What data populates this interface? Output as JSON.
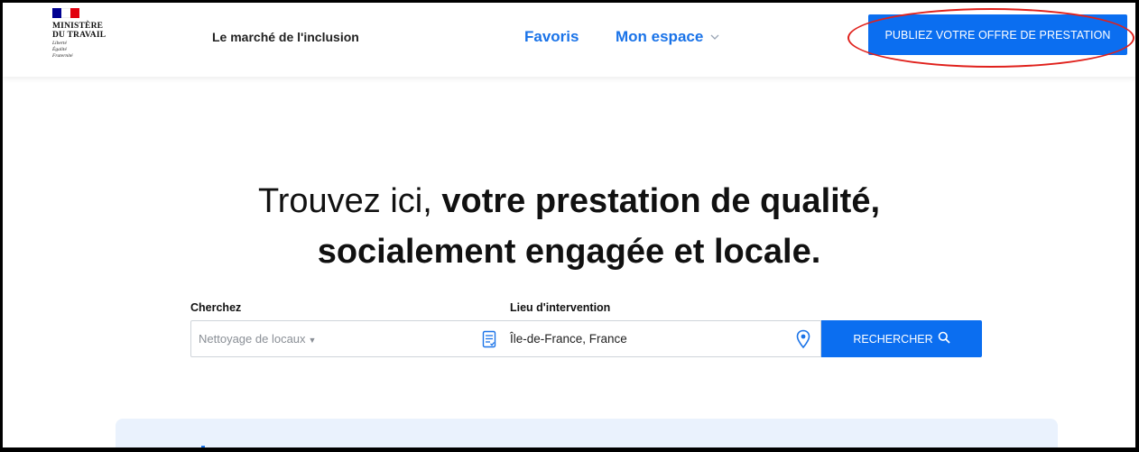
{
  "header": {
    "ministry_line1": "MINISTÈRE",
    "ministry_line2": "DU TRAVAIL",
    "motto": [
      "Liberté",
      "Égalité",
      "Fraternité"
    ],
    "site_name": "Le marché de l'inclusion",
    "nav": {
      "favorites": "Favoris",
      "my_space": "Mon espace"
    },
    "cta_label": "PUBLIEZ VOTRE OFFRE DE PRESTATION"
  },
  "hero": {
    "light_text": "Trouvez ici, ",
    "bold_text_1": "votre prestation de qualité,",
    "bold_text_2": "socialement engagée et locale."
  },
  "search": {
    "search_label": "Cherchez",
    "search_value": "Nettoyage de locaux",
    "place_label": "Lieu d'intervention",
    "place_value": "Île-de-France, France",
    "button_label": "RECHERCHER"
  },
  "colors": {
    "primary": "#0b6ef0",
    "annotation": "#e0211c",
    "panel": "#eaf2fd"
  }
}
